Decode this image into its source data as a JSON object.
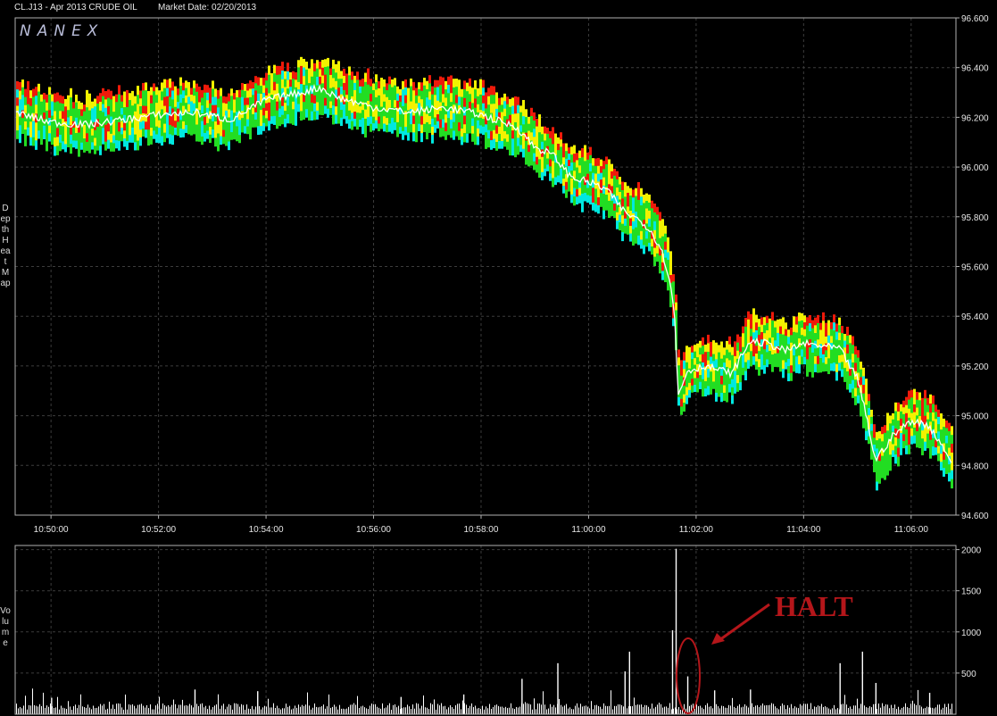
{
  "header": {
    "title": "CL.J13 - Apr 2013 CRUDE OIL",
    "market_date": "Market Date: 02/20/2013"
  },
  "logo": "NANEX",
  "price_panel": {
    "side_label": "Depth Heat Map"
  },
  "volume_panel": {
    "side_label": "Volume"
  },
  "annotation": {
    "text": "HALT",
    "color": "#b4161a"
  },
  "colors": {
    "background": "#000000",
    "frame": "#b0b0b0",
    "grid": "#3c3c3c",
    "heat_green": "#22dd22",
    "heat_yellow": "#f2f200",
    "heat_red": "#ee1a0a",
    "heat_cyan": "#00e8e0",
    "trade_line": "#ffffff",
    "volume_bars": "#ffffff"
  },
  "chart_data": [
    {
      "type": "heatmap",
      "title": "Depth Heat Map",
      "xlabel": "",
      "ylabel": "",
      "x_ticks": [
        "10:50:00",
        "10:52:00",
        "10:54:00",
        "10:56:00",
        "10:58:00",
        "11:00:00",
        "11:02:00",
        "11:04:00",
        "11:06:00"
      ],
      "y_ticks": [
        "96.600",
        "96.400",
        "96.200",
        "96.000",
        "95.800",
        "95.600",
        "95.400",
        "95.200",
        "95.000",
        "94.800",
        "94.600"
      ],
      "ylim": [
        94.6,
        96.6
      ],
      "xlim": [
        "10:49:20",
        "11:06:50"
      ],
      "grid": true,
      "series": [
        {
          "values": [
            [
              "10:49:20",
              96.22
            ],
            [
              "10:50:00",
              96.18
            ],
            [
              "10:50:40",
              96.17
            ],
            [
              "10:51:20",
              96.19
            ],
            [
              "10:52:00",
              96.21
            ],
            [
              "10:52:40",
              96.22
            ],
            [
              "10:53:20",
              96.19
            ],
            [
              "10:54:00",
              96.27
            ],
            [
              "10:54:40",
              96.3
            ],
            [
              "10:55:00",
              96.32
            ],
            [
              "10:55:20",
              96.28
            ],
            [
              "10:56:00",
              96.24
            ],
            [
              "10:56:40",
              96.22
            ],
            [
              "10:57:20",
              96.24
            ],
            [
              "10:58:00",
              96.21
            ],
            [
              "10:58:40",
              96.16
            ],
            [
              "10:59:00",
              96.08
            ],
            [
              "10:59:20",
              96.05
            ],
            [
              "10:59:40",
              95.96
            ],
            [
              "11:00:00",
              95.94
            ],
            [
              "11:00:20",
              95.91
            ],
            [
              "11:00:40",
              95.82
            ],
            [
              "11:01:00",
              95.78
            ],
            [
              "11:01:10",
              95.74
            ],
            [
              "11:01:20",
              95.68
            ],
            [
              "11:01:30",
              95.56
            ],
            [
              "11:01:36",
              95.4
            ],
            [
              "11:01:40",
              95.08
            ],
            [
              "11:01:50",
              95.18
            ],
            [
              "11:02:10",
              95.2
            ],
            [
              "11:02:40",
              95.17
            ],
            [
              "11:03:00",
              95.3
            ],
            [
              "11:03:20",
              95.29
            ],
            [
              "11:03:40",
              95.26
            ],
            [
              "11:04:00",
              95.29
            ],
            [
              "11:04:40",
              95.27
            ],
            [
              "11:05:00",
              95.15
            ],
            [
              "11:05:10",
              95.0
            ],
            [
              "11:05:20",
              94.82
            ],
            [
              "11:05:40",
              94.92
            ],
            [
              "11:06:00",
              94.98
            ],
            [
              "11:06:20",
              94.96
            ],
            [
              "11:06:40",
              94.85
            ],
            [
              "11:06:50",
              94.78
            ]
          ]
        }
      ]
    },
    {
      "type": "bar",
      "title": "Volume",
      "y_ticks": [
        "2000",
        "1500",
        "1000",
        "500"
      ],
      "ylim": [
        0,
        2050
      ],
      "spikes": [
        {
          "t": "11:01:37",
          "v": 2010
        },
        {
          "t": "11:01:33",
          "v": 1020
        },
        {
          "t": "11:01:50",
          "v": 460
        },
        {
          "t": "11:00:45",
          "v": 760
        },
        {
          "t": "11:00:40",
          "v": 520
        },
        {
          "t": "10:59:25",
          "v": 620
        },
        {
          "t": "10:58:45",
          "v": 430
        },
        {
          "t": "11:04:40",
          "v": 620
        },
        {
          "t": "11:05:05",
          "v": 760
        },
        {
          "t": "11:05:20",
          "v": 380
        },
        {
          "t": "10:52:40",
          "v": 300
        },
        {
          "t": "10:53:50",
          "v": 280
        },
        {
          "t": "11:03:00",
          "v": 300
        },
        {
          "t": "11:02:20",
          "v": 290
        },
        {
          "t": "11:06:20",
          "v": 260
        },
        {
          "t": "10:50:00",
          "v": 200
        },
        {
          "t": "10:56:30",
          "v": 210
        },
        {
          "t": "10:57:40",
          "v": 240
        }
      ],
      "baseline_volume": 90
    }
  ]
}
